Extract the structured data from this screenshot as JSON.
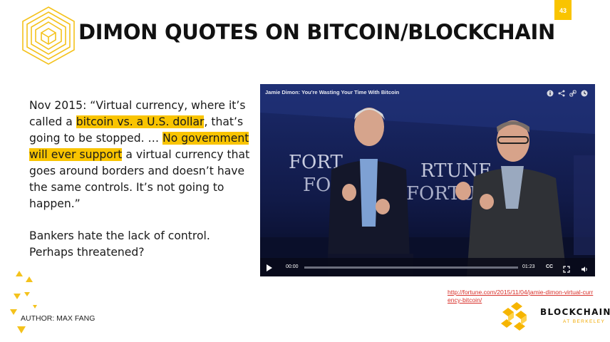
{
  "slide": {
    "page_number": "43",
    "title": "DIMON QUOTES ON BITCOIN/BLOCKCHAIN",
    "quote": {
      "part1": "Nov 2015: “Virtual currency, where it’s called a ",
      "highlight1": "bitcoin vs. a U.S. dollar",
      "part2": ", that’s going to be stopped. … ",
      "highlight2": "No government will ever support",
      "part3": " a virtual currency that goes around borders and doesn’t have the same controls. It’s not going to happen.”"
    },
    "note": "Bankers hate the lack of control. Perhaps threatened?",
    "source_link": "http://fortune.com/2015/11/04/jamie-dimon-virtual-currency-bitcoin/",
    "author": "AUTHOR: MAX FANG",
    "brand": {
      "name": "BLOCKCHAIN",
      "sub": "AT BERKELEY"
    }
  },
  "video": {
    "title": "Jamie Dimon: You're Wasting Your Time With Bitcoin",
    "current_time": "00:00",
    "duration": "01:23",
    "progress": 0.0,
    "cc_label": "CC",
    "backdrop_text": [
      "FORT",
      "FO",
      "RTUNE",
      "FORTU"
    ],
    "icons": [
      "info-icon",
      "share-icon",
      "link-icon",
      "clock-icon",
      "play-icon",
      "fullscreen-icon",
      "volume-icon"
    ]
  },
  "colors": {
    "accent": "#f9c400",
    "link": "#d8302a",
    "text": "#1a1a1a"
  }
}
